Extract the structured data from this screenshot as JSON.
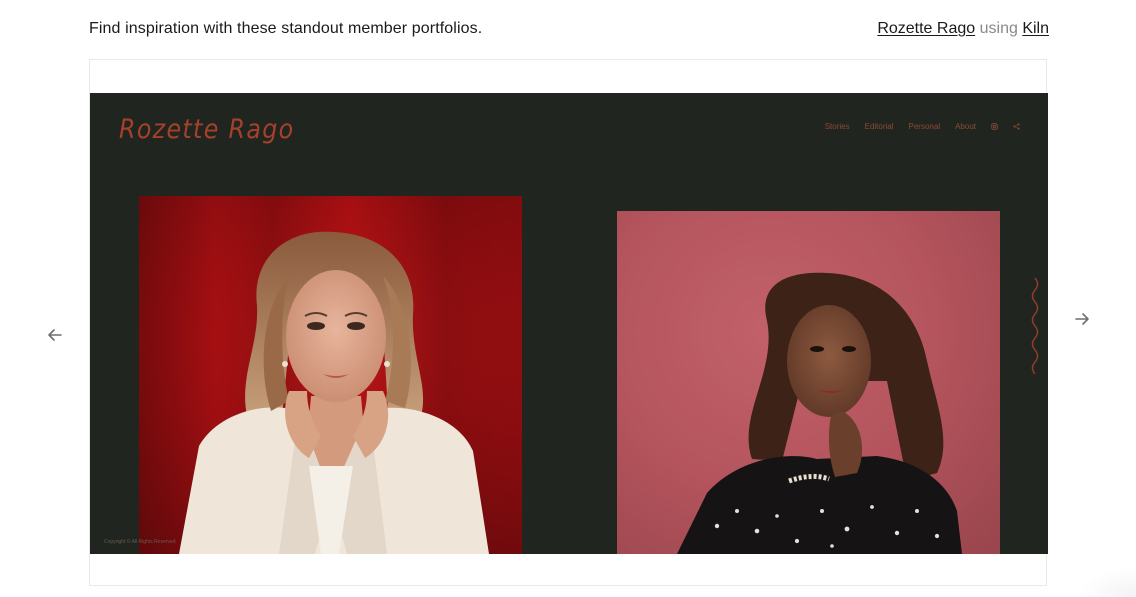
{
  "header": {
    "tagline": "Find inspiration with these standout member portfolios.",
    "author": "Rozette Rago",
    "using_word": "using",
    "template": "Kiln"
  },
  "portfolio_site": {
    "logo": "Rozette Rago",
    "nav": [
      "Stories",
      "Editorial",
      "Personal",
      "About"
    ],
    "nav_icons": [
      "instagram-icon",
      "share-icon"
    ],
    "copyright": "Copyright © All Rights Reserved",
    "accent_color": "#a5412a",
    "background_color": "#212520"
  },
  "carousel": {
    "prev_icon": "arrow-left-icon",
    "next_icon": "arrow-right-icon"
  }
}
